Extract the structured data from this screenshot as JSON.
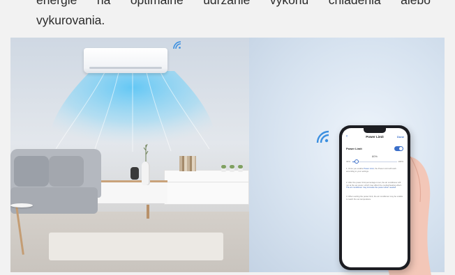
{
  "text": {
    "line1": "energie na optimálne udržanie výkonu chladenia alebo",
    "line2": "vykurovania."
  },
  "phone_app": {
    "back_icon": "chevron-left-icon",
    "title": "Power Limit",
    "action": "Done",
    "setting_label": "Power Limit",
    "toggle_on": true,
    "percent": "80%",
    "slider_min": "30%",
    "slider_max": "100%",
    "slider_fraction": 0.1,
    "notes": [
      {
        "text": "1. Once you enable ",
        "highlight": "Power Limit",
        "rest": ", the Power Limit will work according to your settings."
      },
      {
        "text": "2. After the power limit percentage is set, the air conditioner will run at the set power, which may affect the cooling/heating effect. ",
        "highlight": "The air conditioner may increase the power when needed",
        "rest": "."
      },
      {
        "text": "3. When setting the power limit, the air conditioner may be unable to reach the set temperature.",
        "highlight": "",
        "rest": ""
      }
    ]
  },
  "colors": {
    "accent": "#3b6fc9",
    "airflow": "#4fc3f7",
    "wifi": "#3b8fe0"
  },
  "icons": {
    "wifi_small": "wifi-icon",
    "wifi_large": "wifi-icon"
  }
}
